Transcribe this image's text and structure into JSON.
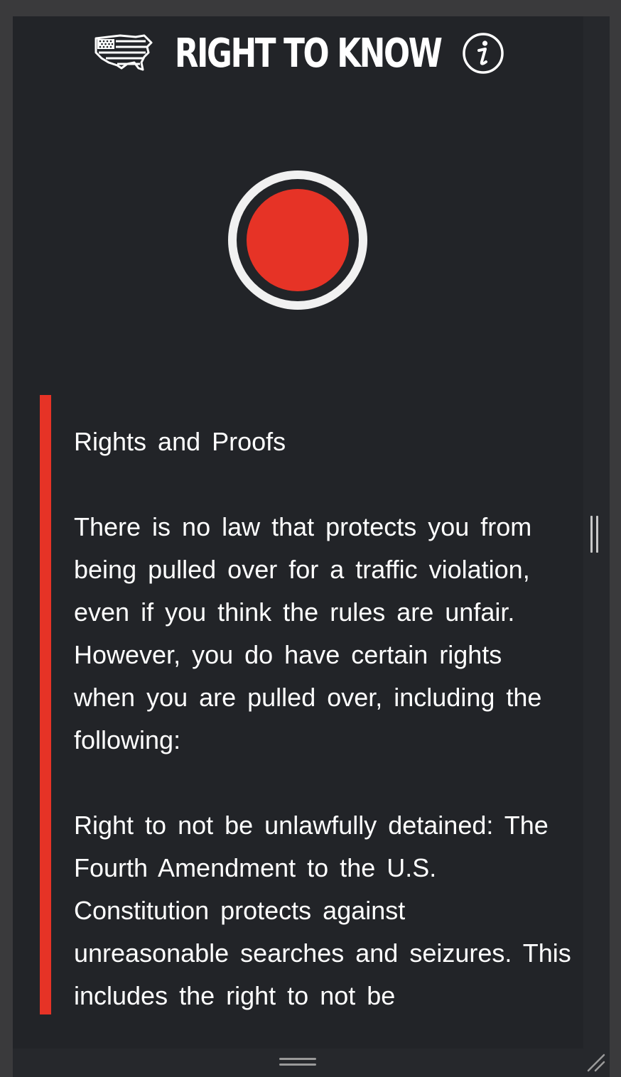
{
  "header": {
    "title": "RIGHT TO KNOW",
    "logo_icon": "us-flag-map-icon",
    "info_icon": "info-icon"
  },
  "record": {
    "icon": "record-button",
    "ring_color": "#f1f1f1",
    "dot_color": "#e63326"
  },
  "content": {
    "accent_color": "#e63326",
    "paragraphs": [
      "Rights and Proofs",
      "There is no law that protects you from being pulled over for a traffic violation, even if you think the rules are unfair. However, you do have certain rights when you are pulled over, including the following:",
      "Right to not be unlawfully detained: The Fourth Amendment to the U.S. Constitution protects against unreasonable searches and seizures. This includes the right to not be"
    ]
  },
  "colors": {
    "background": "#222428",
    "text": "#ffffff",
    "accent": "#e63326"
  }
}
